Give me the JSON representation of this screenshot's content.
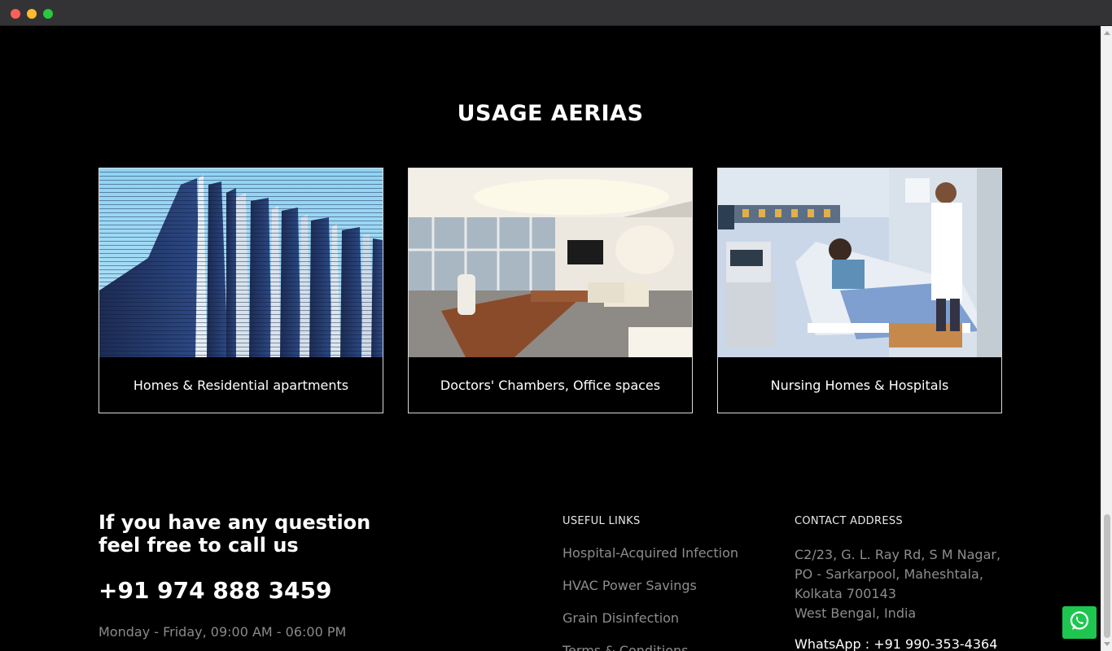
{
  "section": {
    "title": "USAGE AERIAS"
  },
  "cards": [
    {
      "caption": "Homes & Residential apartments"
    },
    {
      "caption": "Doctors' Chambers, Office spaces"
    },
    {
      "caption": "Nursing Homes & Hospitals"
    }
  ],
  "footer": {
    "heading_line1": "If you have any question",
    "heading_line2": "feel free to call us",
    "phone": "+91 974 888 3459",
    "hours": "Monday - Friday, 09:00 AM - 06:00 PM",
    "links_title": "USEFUL LINKS",
    "links": [
      "Hospital-Acquired Infection",
      "HVAC Power Savings",
      "Grain Disinfection",
      "Terms & Conditions"
    ],
    "contact_title": "CONTACT ADDRESS",
    "address": [
      "C2/23, G. L. Ray Rd, S M Nagar,",
      "PO - Sarkarpool, Maheshtala,",
      "Kolkata 700143",
      "West Bengal, India"
    ],
    "whatsapp": "WhatsApp : +91 990-353-4364"
  },
  "colors": {
    "background": "#000000",
    "text": "#ffffff",
    "muted_text": "#8d8d8d",
    "whatsapp_green": "#1ec650"
  },
  "icons": {
    "whatsapp_button": "whatsapp-icon"
  }
}
